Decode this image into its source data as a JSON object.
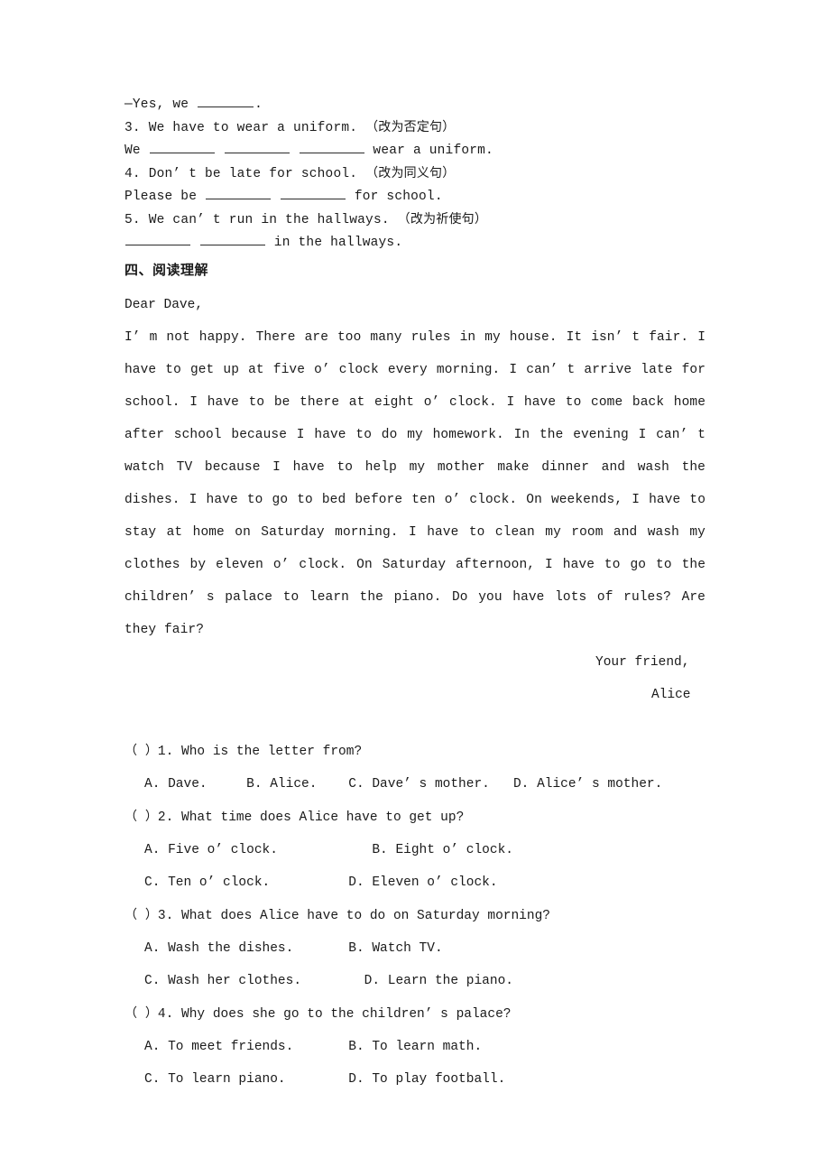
{
  "section_three_tail": {
    "answer_line": "—Yes, we ",
    "answer_line_end": ".",
    "items": [
      {
        "number": "3.",
        "prompt": "We have to wear a uniform.",
        "instruction": "（改为否定句）",
        "answer_prefix": "We ",
        "answer_suffix": " wear a uniform.",
        "blank_count": 3
      },
      {
        "number": "4.",
        "prompt": "Don’ t be late for school.",
        "instruction": "（改为同义句）",
        "answer_prefix": "Please be ",
        "answer_suffix": " for school.",
        "blank_count": 2
      },
      {
        "number": "5.",
        "prompt": "We can’ t run in the hallways.",
        "instruction": "（改为祈使句）",
        "answer_prefix": "",
        "answer_suffix": " in the hallways.",
        "blank_count": 2
      }
    ]
  },
  "section_four": {
    "heading": "四、阅读理解",
    "letter": {
      "salutation": "Dear Dave,",
      "body": "I’ m not happy. There are too many rules in my house. It isn’ t fair. I have to get up at five o’ clock every morning. I can’ t arrive late for school. I have to be there at eight o’ clock. I have to come back home after school because I have to do my homework. In the evening I can’ t watch TV because I have to help my mother make dinner and wash the dishes. I have to go to bed before ten o’ clock. On weekends, I have to stay at home on Saturday morning. I have to clean my room and wash my clothes by eleven o’ clock. On Saturday afternoon, I have to go to the children’ s palace to learn the piano. Do you have lots of rules? Are they fair?",
      "closing": "Your friend,",
      "signature": "Alice"
    },
    "questions": [
      {
        "marker": "（  ）",
        "number": "1.",
        "text": "Who is the letter from?",
        "option_rows": [
          "A. Dave.     B. Alice.    C. Dave’ s mother.   D. Alice’ s mother."
        ]
      },
      {
        "marker": "（  ）",
        "number": "2.",
        "text": "What time does Alice have to get up?",
        "option_rows": [
          "A. Five o’ clock.            B. Eight o’ clock.",
          "C. Ten o’ clock.          D. Eleven o’ clock."
        ]
      },
      {
        "marker": "（  ）",
        "number": "3.",
        "text": "What does Alice have to do on Saturday morning?",
        "option_rows": [
          "A. Wash the dishes.       B. Watch TV.",
          "C. Wash her clothes.        D. Learn the piano."
        ]
      },
      {
        "marker": "（  ）",
        "number": "4.",
        "text": "Why does she go to the children’ s palace?",
        "option_rows": [
          "A. To meet friends.       B. To learn math.",
          "C. To learn piano.        D. To play football."
        ]
      }
    ]
  }
}
